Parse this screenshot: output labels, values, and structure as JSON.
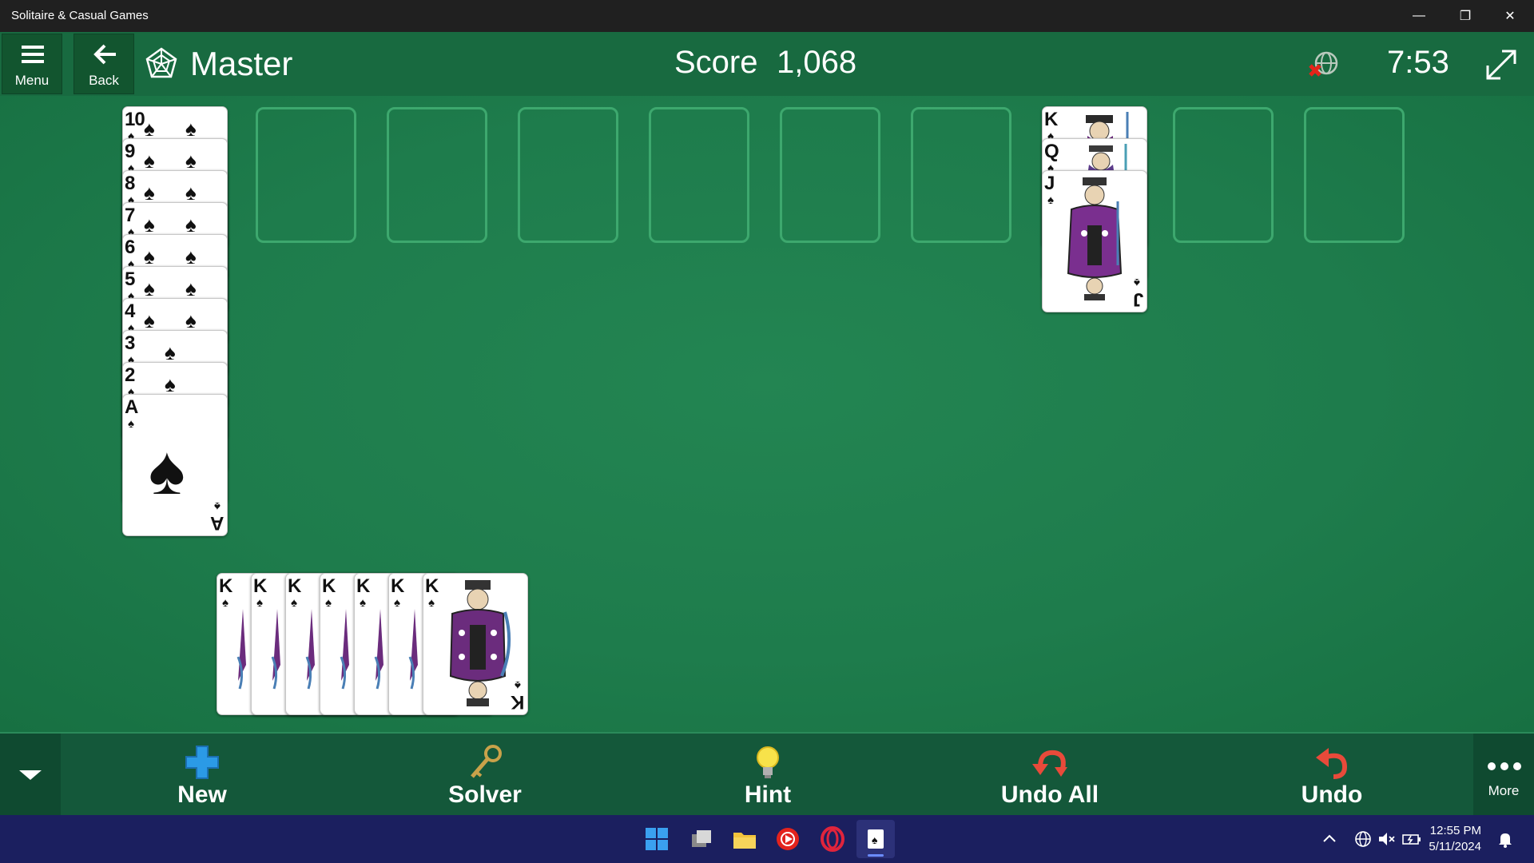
{
  "window": {
    "title": "Solitaire & Casual Games"
  },
  "header": {
    "menu_label": "Menu",
    "back_label": "Back",
    "level": "Master",
    "score_label": "Score",
    "score_value": "1,068",
    "timer": "7:53"
  },
  "tableau": {
    "spade_run": [
      "10",
      "9",
      "8",
      "7",
      "6",
      "5",
      "4",
      "3",
      "2",
      "A"
    ],
    "royal_stack": [
      "K",
      "Q",
      "J"
    ],
    "stock_kings": [
      "K",
      "K",
      "K",
      "K",
      "K",
      "K",
      "K"
    ],
    "empty_slots": 8
  },
  "toolbar": {
    "new_label": "New",
    "solver_label": "Solver",
    "hint_label": "Hint",
    "undo_all_label": "Undo All",
    "undo_label": "Undo",
    "more_label": "More"
  },
  "taskbar": {
    "time": "12:55 PM",
    "date": "5/11/2024"
  },
  "colors": {
    "felt": "#1d7a4c",
    "header": "#186a40",
    "taskbar": "#1b1f5f"
  }
}
